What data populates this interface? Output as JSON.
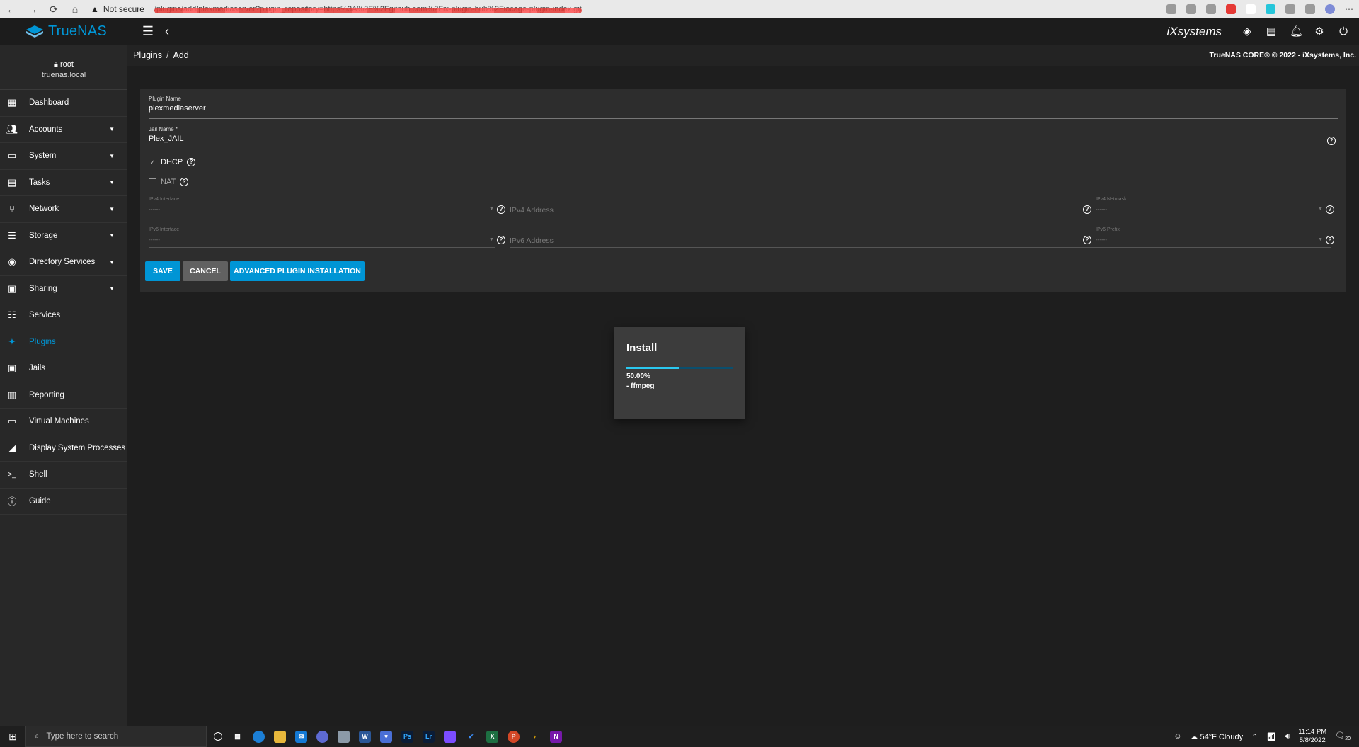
{
  "browser": {
    "security_label": "Not secure",
    "url_fragment": "/plugins/add/plexmediaserver?plugin_repository=https%3A%2F%2Fgithub.com%2Fix-plugin-hub%2Fiocage-plugin-index.git"
  },
  "app": {
    "brand": "TrueNAS",
    "brand_sub": "CORE",
    "vendor": "iXsystems"
  },
  "user": {
    "name": "root",
    "host": "truenas.local"
  },
  "sidebar": {
    "items": [
      {
        "label": "Dashboard",
        "icon": "dashboard-icon",
        "has_arrow": false
      },
      {
        "label": "Accounts",
        "icon": "people-icon",
        "has_arrow": true
      },
      {
        "label": "System",
        "icon": "laptop-icon",
        "has_arrow": true
      },
      {
        "label": "Tasks",
        "icon": "calendar-icon",
        "has_arrow": true
      },
      {
        "label": "Network",
        "icon": "network-icon",
        "has_arrow": true
      },
      {
        "label": "Storage",
        "icon": "list-icon",
        "has_arrow": true
      },
      {
        "label": "Directory Services",
        "icon": "directory-icon",
        "has_arrow": true
      },
      {
        "label": "Sharing",
        "icon": "folder-share-icon",
        "has_arrow": true
      },
      {
        "label": "Services",
        "icon": "tune-icon",
        "has_arrow": false
      },
      {
        "label": "Plugins",
        "icon": "puzzle-icon",
        "has_arrow": false,
        "active": true
      },
      {
        "label": "Jails",
        "icon": "jail-icon",
        "has_arrow": false
      },
      {
        "label": "Reporting",
        "icon": "chart-icon",
        "has_arrow": false
      },
      {
        "label": "Virtual Machines",
        "icon": "monitor-icon",
        "has_arrow": false
      },
      {
        "label": "Display System Processes",
        "icon": "processes-icon",
        "has_arrow": false
      },
      {
        "label": "Shell",
        "icon": "terminal-icon",
        "has_arrow": false
      },
      {
        "label": "Guide",
        "icon": "info-icon",
        "has_arrow": false
      }
    ]
  },
  "breadcrumb": {
    "parent": "Plugins",
    "separator": "/",
    "current": "Add"
  },
  "copyright": "TrueNAS CORE® © 2022 - iXsystems, Inc.",
  "form": {
    "plugin_name_label": "Plugin Name",
    "plugin_name_value": "plexmediaserver",
    "jail_name_label": "Jail Name *",
    "jail_name_value": "Plex_JAIL",
    "dhcp_label": "DHCP",
    "dhcp_checked": true,
    "nat_label": "NAT",
    "nat_checked": false,
    "ipv4_interface_label": "IPv4 Interface",
    "ipv4_interface_value": "------",
    "ipv4_address_placeholder": "IPv4 Address",
    "ipv4_netmask_label": "IPv4 Netmask",
    "ipv4_netmask_value": "------",
    "ipv6_interface_label": "IPv6 Interface",
    "ipv6_interface_value": "------",
    "ipv6_address_placeholder": "IPv6 Address",
    "ipv6_prefix_label": "IPv6 Prefix",
    "ipv6_prefix_value": "------",
    "save_label": "SAVE",
    "cancel_label": "CANCEL",
    "advanced_label": "ADVANCED PLUGIN INSTALLATION"
  },
  "dialog": {
    "title": "Install",
    "progress": 0.5,
    "progress_text": "50.00%",
    "task": "- ffmpeg"
  },
  "taskbar": {
    "search_placeholder": "Type here to search",
    "weather": "54°F  Cloudy",
    "time": "11:14 PM",
    "date": "5/8/2022",
    "notification_count": "20"
  },
  "colors": {
    "accent": "#0095d5",
    "progress": "#2bc8f0",
    "sidebar_bg": "#282828",
    "page_bg": "#1e1e1e"
  }
}
